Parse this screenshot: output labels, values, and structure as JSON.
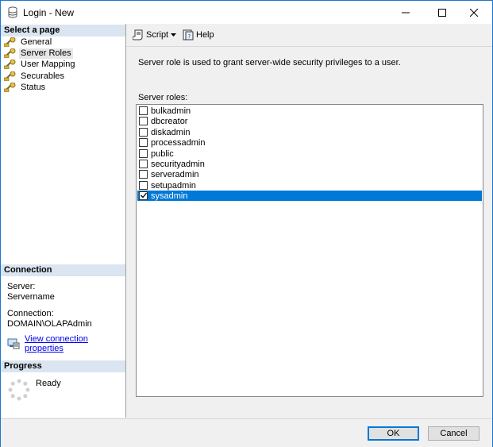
{
  "window": {
    "title": "Login - New",
    "accent_color": "#0078d7"
  },
  "left": {
    "select_page_header": "Select a page",
    "pages": [
      {
        "label": "General",
        "icon": "wrench-icon"
      },
      {
        "label": "Server Roles",
        "icon": "wrench-icon",
        "selected": true
      },
      {
        "label": "User Mapping",
        "icon": "wrench-icon"
      },
      {
        "label": "Securables",
        "icon": "wrench-icon"
      },
      {
        "label": "Status",
        "icon": "wrench-icon"
      }
    ],
    "connection_header": "Connection",
    "server_label": "Server:",
    "server_value": "Servername",
    "connection_label": "Connection:",
    "connection_value": "DOMAIN\\OLAPAdmin",
    "view_connection_link": "View connection properties",
    "progress_header": "Progress",
    "progress_status": "Ready"
  },
  "toolbar": {
    "script_label": "Script",
    "help_label": "Help"
  },
  "main": {
    "description": "Server role is used to grant server-wide security privileges to a user.",
    "roles_label": "Server roles:",
    "roles": [
      {
        "name": "bulkadmin",
        "checked": false
      },
      {
        "name": "dbcreator",
        "checked": false
      },
      {
        "name": "diskadmin",
        "checked": false
      },
      {
        "name": "processadmin",
        "checked": false
      },
      {
        "name": "public",
        "checked": false
      },
      {
        "name": "securityadmin",
        "checked": false
      },
      {
        "name": "serveradmin",
        "checked": false
      },
      {
        "name": "setupadmin",
        "checked": false
      },
      {
        "name": "sysadmin",
        "checked": true,
        "selected": true
      }
    ]
  },
  "buttons": {
    "ok": "OK",
    "cancel": "Cancel"
  }
}
